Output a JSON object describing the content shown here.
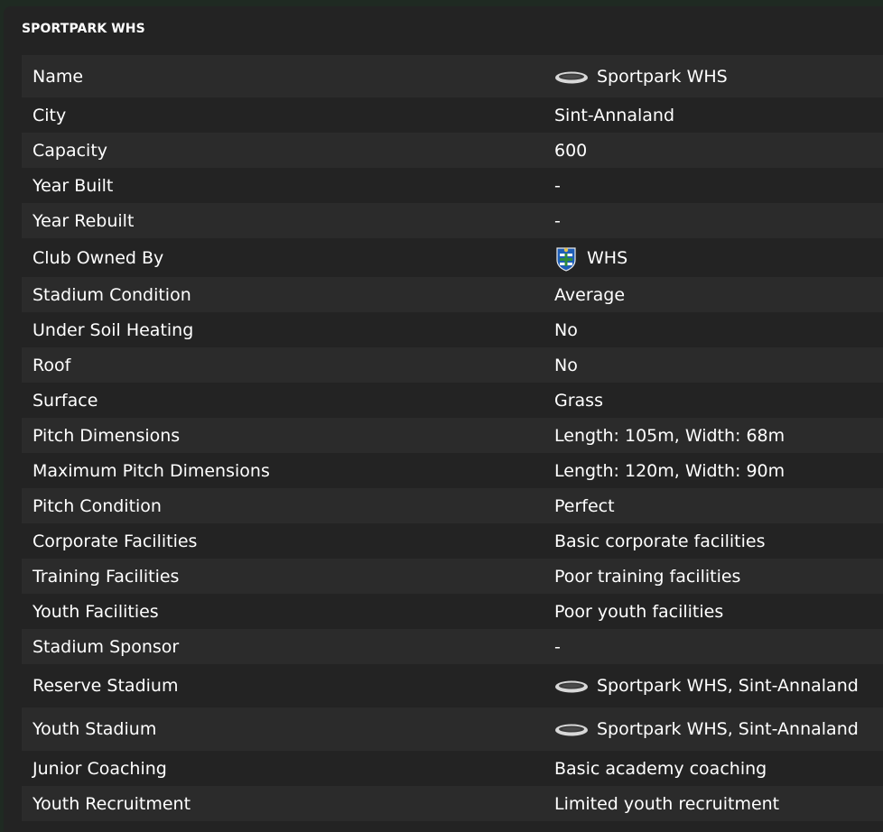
{
  "panel": {
    "title": "SPORTPARK WHS"
  },
  "rows": [
    {
      "label": "Name",
      "value": "Sportpark WHS",
      "icon": "stadium-icon"
    },
    {
      "label": "City",
      "value": "Sint-Annaland"
    },
    {
      "label": "Capacity",
      "value": "600"
    },
    {
      "label": "Year Built",
      "value": "-"
    },
    {
      "label": "Year Rebuilt",
      "value": "-"
    },
    {
      "label": "Club Owned By",
      "value": "WHS",
      "icon": "club-crest-icon"
    },
    {
      "label": "Stadium Condition",
      "value": "Average"
    },
    {
      "label": "Under Soil Heating",
      "value": "No"
    },
    {
      "label": "Roof",
      "value": "No"
    },
    {
      "label": "Surface",
      "value": "Grass"
    },
    {
      "label": "Pitch Dimensions",
      "value": "Length: 105m, Width: 68m"
    },
    {
      "label": "Maximum Pitch Dimensions",
      "value": "Length: 120m, Width: 90m"
    },
    {
      "label": "Pitch Condition",
      "value": "Perfect"
    },
    {
      "label": "Corporate Facilities",
      "value": "Basic corporate facilities"
    },
    {
      "label": "Training Facilities",
      "value": "Poor training facilities"
    },
    {
      "label": "Youth Facilities",
      "value": "Poor youth facilities"
    },
    {
      "label": "Stadium Sponsor",
      "value": "-"
    },
    {
      "label": "Reserve Stadium",
      "value": "Sportpark WHS, Sint-Annaland",
      "icon": "stadium-icon"
    },
    {
      "label": "Youth Stadium",
      "value": "Sportpark WHS, Sint-Annaland",
      "icon": "stadium-icon"
    },
    {
      "label": "Junior Coaching",
      "value": "Basic academy coaching"
    },
    {
      "label": "Youth Recruitment",
      "value": "Limited youth recruitment"
    }
  ],
  "colors": {
    "panel_bg": "#232323",
    "row_alt_bg": "#2b2b2b",
    "text": "#ffffff"
  }
}
